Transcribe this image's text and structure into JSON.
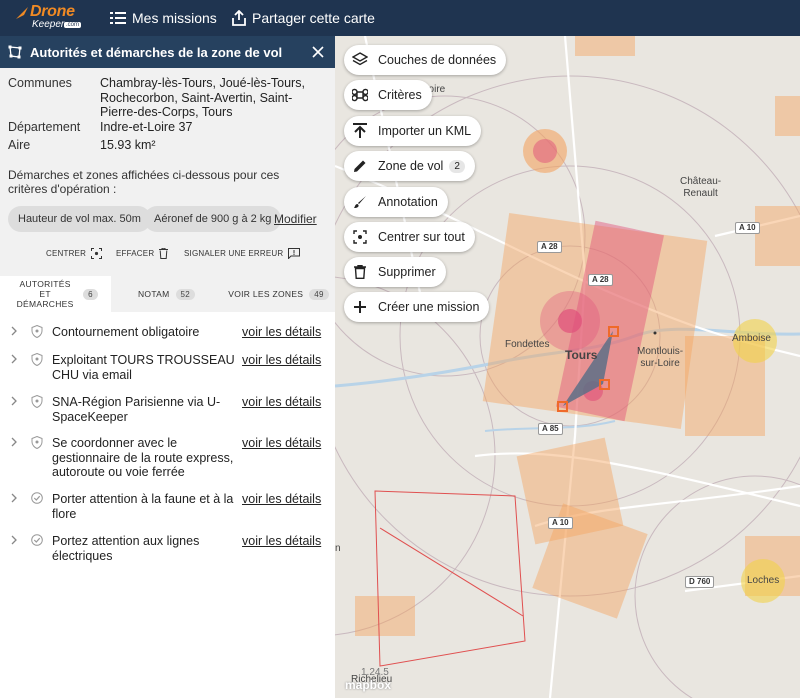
{
  "app": {
    "logo_main": "Drone",
    "logo_sub": "Keeper",
    "logo_domain": ".com",
    "nav_missions": "Mes missions",
    "nav_share": "Partager cette carte"
  },
  "panel": {
    "title": "Autorités et démarches de la zone de vol",
    "info": {
      "communes_label": "Communes",
      "communes_value": "Chambray-lès-Tours, Joué-lès-Tours, Rochecorbon, Saint-Avertin, Saint-Pierre-des-Corps, Tours",
      "departement_label": "Département",
      "departement_value": "Indre-et-Loire 37",
      "aire_label": "Aire",
      "aire_value": "15.93 km²"
    },
    "note": "Démarches et zones affichées ci-dessous pour ces critères d'opération :",
    "chip_height": "Hauteur de vol max. 50m",
    "chip_aircraft": "Aéronef de 900 g à 2 kg",
    "modify_link": "Modifier",
    "actions": {
      "center": "CENTRER",
      "clear": "EFFACER",
      "report": "SIGNALER UNE ERREUR"
    },
    "tabs": [
      {
        "label": "AUTORITÉS ET DÉMARCHES",
        "count": "6"
      },
      {
        "label": "NOTAM",
        "count": "52"
      },
      {
        "label": "VOIR LES ZONES",
        "count": "49"
      }
    ],
    "items": [
      {
        "text": "Contournement obligatoire",
        "link": "voir les détails",
        "icon": "shield-icon"
      },
      {
        "text": "Exploitant TOURS TROUSSEAU CHU via email",
        "link": "voir les détails",
        "icon": "shield-icon"
      },
      {
        "text": "SNA-Région Parisienne via U-SpaceKeeper",
        "link": "voir les détails",
        "icon": "shield-icon"
      },
      {
        "text": "Se coordonner avec le gestionnaire de la route express, autoroute ou voie ferrée",
        "link": "voir les détails",
        "icon": "shield-icon"
      },
      {
        "text": "Porter attention à la faune et à la flore",
        "link": "voir les détails",
        "icon": "check-circle-icon"
      },
      {
        "text": "Portez attention aux lignes électriques",
        "link": "voir les détails",
        "icon": "check-circle-icon"
      }
    ]
  },
  "map": {
    "buttons": [
      {
        "label": "Couches de données",
        "icon": "layers-icon"
      },
      {
        "label": "Critères",
        "icon": "command-icon"
      },
      {
        "label": "Importer un KML",
        "icon": "upload-icon"
      },
      {
        "label": "Zone de vol",
        "icon": "pencil-icon",
        "badge": "2"
      },
      {
        "label": "Annotation",
        "icon": "brush-icon"
      },
      {
        "label": "Centrer sur tout",
        "icon": "focus-icon"
      },
      {
        "label": "Supprimer",
        "icon": "trash-icon"
      },
      {
        "label": "Créer une mission",
        "icon": "plus-icon"
      }
    ],
    "places": {
      "chateau": "Château-\nRenault",
      "fondettes": "Fondettes",
      "tours": "Tours",
      "montlouis": "Montlouis-\nsur-Loire",
      "amboise": "Amboise",
      "loches": "Loches",
      "richelieu": "Richelieu",
      "loire_frag": "Loire",
      "n_frag": "n"
    },
    "roads": {
      "a28_1": "A 28",
      "a28_2": "A 28",
      "a10_1": "A 10",
      "a85": "A 85",
      "a10_2": "A 10",
      "d760": "D 760"
    },
    "version": "1.24.5",
    "attribution": "mapbox"
  },
  "colors": {
    "topbar": "#1f3450",
    "panel_header": "#26415f",
    "brand_orange": "#f08a24",
    "zone_pink": "#e0507a",
    "zone_orange": "#f4a460"
  }
}
